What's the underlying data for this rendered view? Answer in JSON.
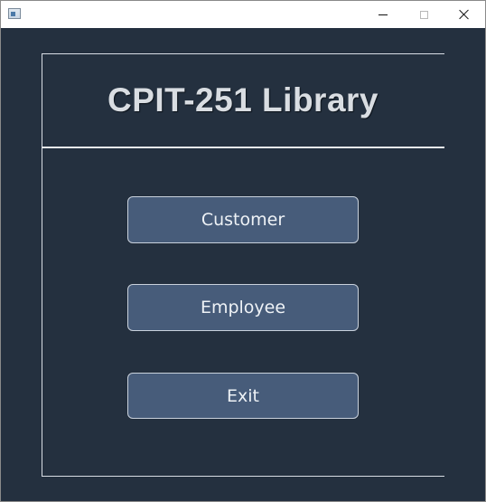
{
  "window": {
    "title": "",
    "controls": {
      "minimize_icon": "minimize-icon",
      "maximize_icon": "maximize-icon",
      "close_icon": "close-icon"
    }
  },
  "header": {
    "title": "CPIT-251 Library"
  },
  "menu": {
    "customer_label": "Customer",
    "employee_label": "Employee",
    "exit_label": "Exit"
  },
  "colors": {
    "background": "#24303f",
    "button_fill": "#475c7a",
    "button_border": "#c9d1dc",
    "title_text": "#d9dde2"
  }
}
